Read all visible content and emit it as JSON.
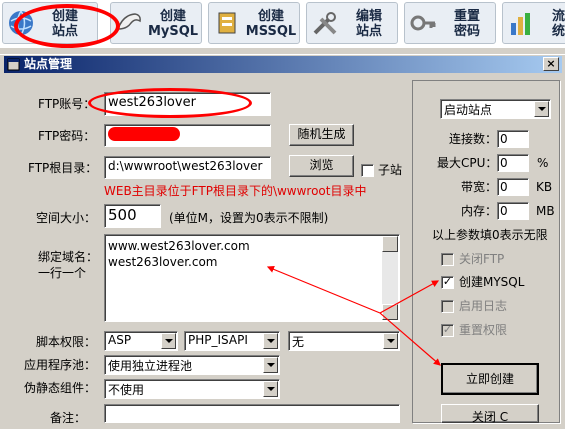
{
  "toolbar": {
    "buttons": [
      {
        "label": "创建\n站点"
      },
      {
        "label": "创建\nMySQL"
      },
      {
        "label": "创建\nMSSQL"
      },
      {
        "label": "编辑\n站点"
      },
      {
        "label": "重置\n密码"
      },
      {
        "label": "流量\n统计"
      }
    ]
  },
  "window": {
    "title": "站点管理",
    "close": "×"
  },
  "form": {
    "ftp_account_label": "FTP账号：",
    "ftp_account_value": "west263lover",
    "ftp_password_label": "FTP密码：",
    "random_button": "随机生成",
    "ftp_root_label": "FTP根目录：",
    "ftp_root_value": "d:\\wwwroot\\west263lover",
    "browse_button": "浏览",
    "subsite_label": "子站",
    "root_hint": "WEB主目录位于FTP根目录下的\\wwwroot目录中",
    "space_label": "空间大小：",
    "space_value": "500",
    "space_hint": "(单位M，设置为0表示不限制)",
    "domain_label_1": "绑定域名：",
    "domain_label_2": "一行一个",
    "domain_line_1": "www.west263lover.com",
    "domain_line_2": "west263lover.com",
    "script_label": "脚本权限：",
    "script_select_1": "ASP",
    "script_select_2": "PHP_ISAPI",
    "script_select_3": "无",
    "pool_label": "应用程序池：",
    "pool_value": "使用独立进程池",
    "rewrite_label": "伪静态组件：",
    "rewrite_value": "不使用",
    "note_label": "备注："
  },
  "right": {
    "start_select": "启动站点",
    "conn_label": "连接数：",
    "conn_value": "0",
    "cpu_label": "最大CPU：",
    "cpu_value": "0",
    "cpu_unit": "%",
    "bw_label": "带宽：",
    "bw_value": "0",
    "bw_unit": "KB",
    "mem_label": "内存：",
    "mem_value": "0",
    "mem_unit": "MB",
    "zero_hint": "以上参数填0表示无限",
    "close_ftp": "关闭FTP",
    "create_mysql": "创建MYSQL",
    "enable_log": "启用日志",
    "reset_perm": "重置权限",
    "create_now": "立即创建",
    "close_button": "关闭 C"
  },
  "colors": {
    "annotation": "#ff0000",
    "titlebar": "#0a246a",
    "hint": "#e00000"
  }
}
